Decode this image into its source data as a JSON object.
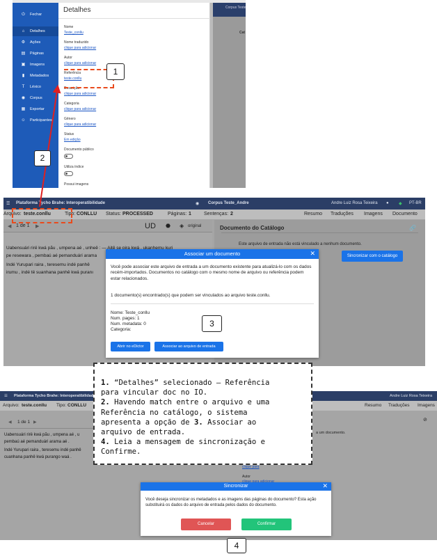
{
  "panel1": {
    "sidebar": [
      {
        "icon": "power-icon",
        "glyph": "⏻",
        "label": "Fechar",
        "active": false
      },
      {
        "icon": "home-icon",
        "glyph": "⌂",
        "label": "Detalhes",
        "active": true
      },
      {
        "icon": "gears-icon",
        "glyph": "⚙",
        "label": "Ações",
        "active": false
      },
      {
        "icon": "file-icon",
        "glyph": "▤",
        "label": "Páginas",
        "active": false
      },
      {
        "icon": "image-icon",
        "glyph": "▣",
        "label": "Imagens",
        "active": false
      },
      {
        "icon": "bookmark-icon",
        "glyph": "▮",
        "label": "Metadados",
        "active": false
      },
      {
        "icon": "text-icon",
        "glyph": "T",
        "label": "Léxico",
        "active": false
      },
      {
        "icon": "database-icon",
        "glyph": "◉",
        "label": "Corpus",
        "active": false
      },
      {
        "icon": "export-icon",
        "glyph": "▦",
        "label": "Exportar",
        "active": false
      },
      {
        "icon": "users-icon",
        "glyph": "☺",
        "label": "Participantes",
        "active": false
      }
    ],
    "details_title": "Detalhes",
    "fields": [
      {
        "label": "Nome",
        "value": "Teste_conllu"
      },
      {
        "label": "Nome traduzido",
        "value": "clique para adicionar"
      },
      {
        "label": "Autor",
        "value": "clique para adicionar"
      },
      {
        "label": "Referência",
        "value": "teste.conllu"
      },
      {
        "label": "Descrição",
        "value": "clique para adicionar"
      },
      {
        "label": "Categoria",
        "value": "clique para adicionar"
      },
      {
        "label": "Gênero",
        "value": "clique para adicionar"
      },
      {
        "label": "Status",
        "value": "Em edição"
      }
    ],
    "toggles": [
      {
        "label": "Documento público"
      },
      {
        "label": "Utiliza índice"
      }
    ],
    "cut_label": "Possui imagens",
    "right_header": "Corpus Teste",
    "right_col": "Cat"
  },
  "panel2": {
    "nav": {
      "app_name": "Plataforma Tycho Brahe: Interoperatibilidade",
      "corpus": "Corpus Teste_Andre",
      "user": "Andre Luiz Rosa Teixeira",
      "lang": "PT-BR"
    },
    "sub": {
      "arquivo_label": "Arquivo:",
      "arquivo": "teste.conllu",
      "tipo_label": "Tipo:",
      "tipo": "CONLLU",
      "status_label": "Status:",
      "status": "PROCESSED",
      "paginas_label": "Páginas:",
      "paginas": "1",
      "sentencas_label": "Sentenças:",
      "sentencas": "2",
      "tabs": [
        "Resumo",
        "Traduções",
        "Imagens",
        "Documento"
      ]
    },
    "pager": "1 de 1",
    "ud": "UD",
    "original": "original",
    "text_lines": [
      "Uabensuári rirë kwá pãu , umpena aé , unheê : — Aitê se pira kwá , ukanhemu kuri",
      "pe resewara , pembaú aé pemanduári arama",
      "Indé Yurupari raira , teresemu indé panhê",
      "irumu , indé të suanhana panhê kwá puranı"
    ],
    "doc_title": "Documento do Catálogo",
    "doc_msg": "Este arquivo de entrada não está vinculado a nenhum documento.",
    "sync_btn": "Sincronizar com o catálogo",
    "modal": {
      "title": "Associar um documento",
      "p1": "Você pode associar este arquivo de entrada a um documento existente para atualizá-lo com os dados recém-importados. Documentos no catálogo com o mesmo nome de arquivo ou referência podem estar relacionados.",
      "p2": "1 documento(s) encontrado(s) que podem ser vinculados ao arquivo teste.conllu.",
      "info": [
        "Nome: Teste_conllu",
        "Num. pages: 1",
        "Num. metadata: 0",
        "Categoria:"
      ],
      "btn_open": "Abrir no eDictor",
      "btn_assoc": "Associar ao arquivo de entrada"
    }
  },
  "panel4": {
    "nav": {
      "app_name": "Plataforma Tycho Brahe: Interoperatibilidade",
      "user": "Andre Luiz Rosa Teixeira"
    },
    "sub": {
      "arquivo_label": "Arquivo:",
      "arquivo": "teste.conllu",
      "tipo_label": "Tipo:",
      "tipo": "CONLLU",
      "tabs": [
        "Resumo",
        "Traduções",
        "Imagens"
      ]
    },
    "pager": "1 de 1",
    "text_lines": [
      "Uabensuári rirë kwá pãu , umpena aé , u",
      "pembaú aé pemanduári arama aé .",
      "Indé Yurupari raira , teresemu indé panhê",
      "cuanhana panhê kwá purango waá ."
    ],
    "right_msg": "a um documento.",
    "right_field": "Autor",
    "right_value": "clique para adicionar",
    "right_partial": "clique para",
    "modal": {
      "title": "Sincronizar",
      "text": "Você deseja sincronizar os metadados e as imagens das páginas do documento? Esta ação substituirá os dados do arquivo de entrada pelos dados do documento.",
      "cancel": "Cancelar",
      "confirm": "Confirmar"
    }
  },
  "callouts": [
    "1",
    "2",
    "3",
    "4"
  ],
  "notes": [
    {
      "n": "1.",
      "text": " “Detalhes” selecionado – Referência"
    },
    {
      "n": "",
      "text": "para vincular doc no IO."
    },
    {
      "n": "2.",
      "text": " Havendo match entre o arquivo e uma"
    },
    {
      "n": "",
      "text": "Referência no catálogo, o sistema"
    },
    {
      "n": "",
      "text": "apresenta a opção de ",
      "n2": "3.",
      "text2": " Associar ao"
    },
    {
      "n": "",
      "text": "arquivo de entrada."
    },
    {
      "n": "4.",
      "text": " Leia a mensagem de sincronização e"
    },
    {
      "n": "",
      "text": "Confirme."
    }
  ],
  "colors": {
    "sidebar": "#1e5bb8",
    "navbar": "#2b3e66",
    "primary": "#1a73e8",
    "danger": "#e05555",
    "success": "#22c47a",
    "callout": "#e94a1c"
  }
}
